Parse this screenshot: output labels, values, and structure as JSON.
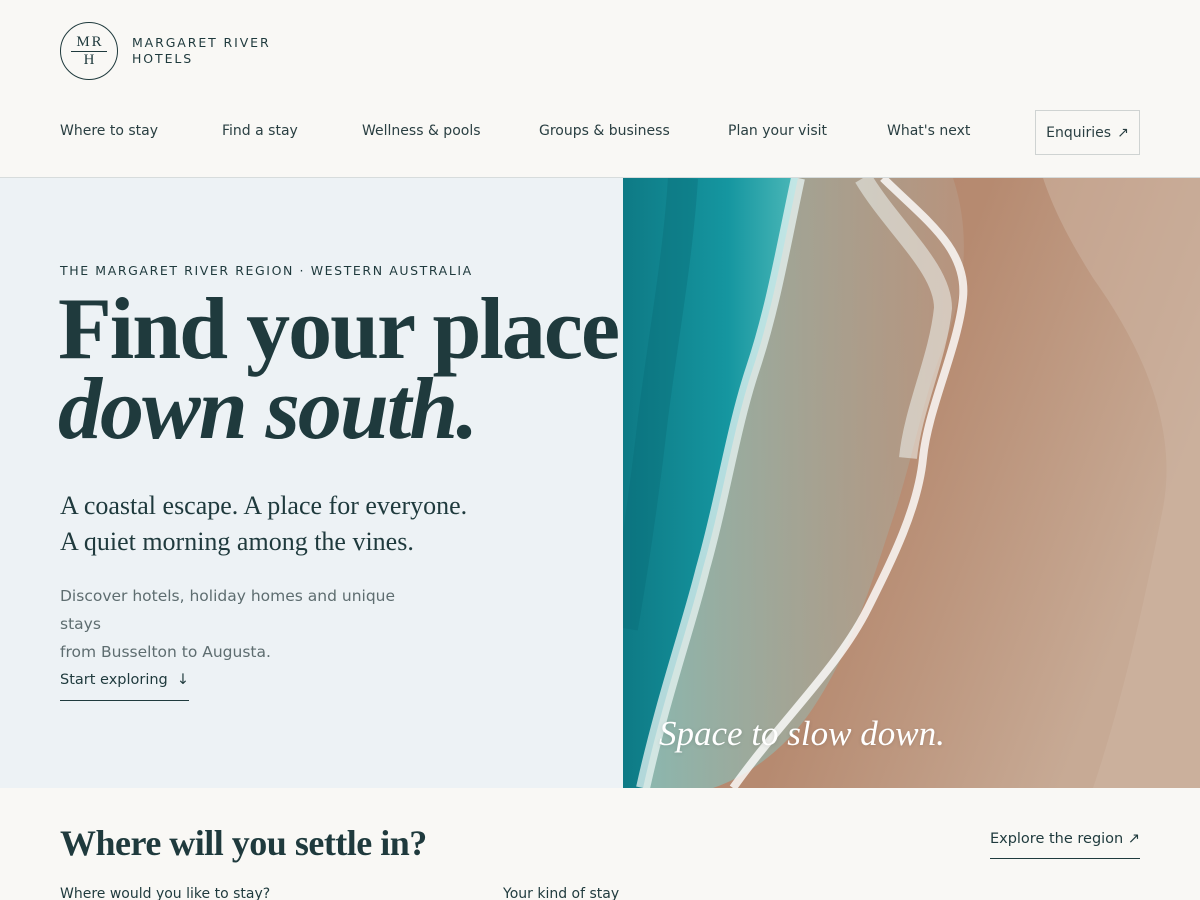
{
  "brand": {
    "monogram_top": "MR",
    "monogram_bottom": "H",
    "name_line1": "MARGARET RIVER",
    "name_line2": "HOTELS"
  },
  "nav": {
    "items": [
      "Where to stay",
      "Find a stay",
      "Wellness & pools",
      "Groups & business",
      "Plan your visit",
      "What's next"
    ],
    "enquiries_label": "Enquiries",
    "enquiries_icon": "arrow-up-right-icon"
  },
  "hero": {
    "eyebrow": "THE MARGARET RIVER REGION · WESTERN AUSTRALIA",
    "headline_line1": "Find your place",
    "headline_line2": "down south.",
    "lede_line1": "A coastal escape. A place for everyone.",
    "lede_line2": "A quiet morning among the vines.",
    "body_line1": "Discover hotels, holiday homes and unique stays",
    "body_line2": "from Busselton to Augusta.",
    "cta_label": "Start exploring",
    "cta_icon": "arrow-down-icon",
    "image_caption": "Space to slow down."
  },
  "search": {
    "title": "Where will you settle in?",
    "explore_label": "Explore the region ↗",
    "location_label": "Where would you like to stay?",
    "stay_type_label": "Your kind of stay"
  },
  "colors": {
    "ink": "#1f3a3d",
    "page_bg": "#f9f8f5",
    "hero_panel_bg": "#edf2f5",
    "muted_text": "#5e6d70",
    "ocean": "#1a8c94",
    "sand": "#b8886a"
  }
}
